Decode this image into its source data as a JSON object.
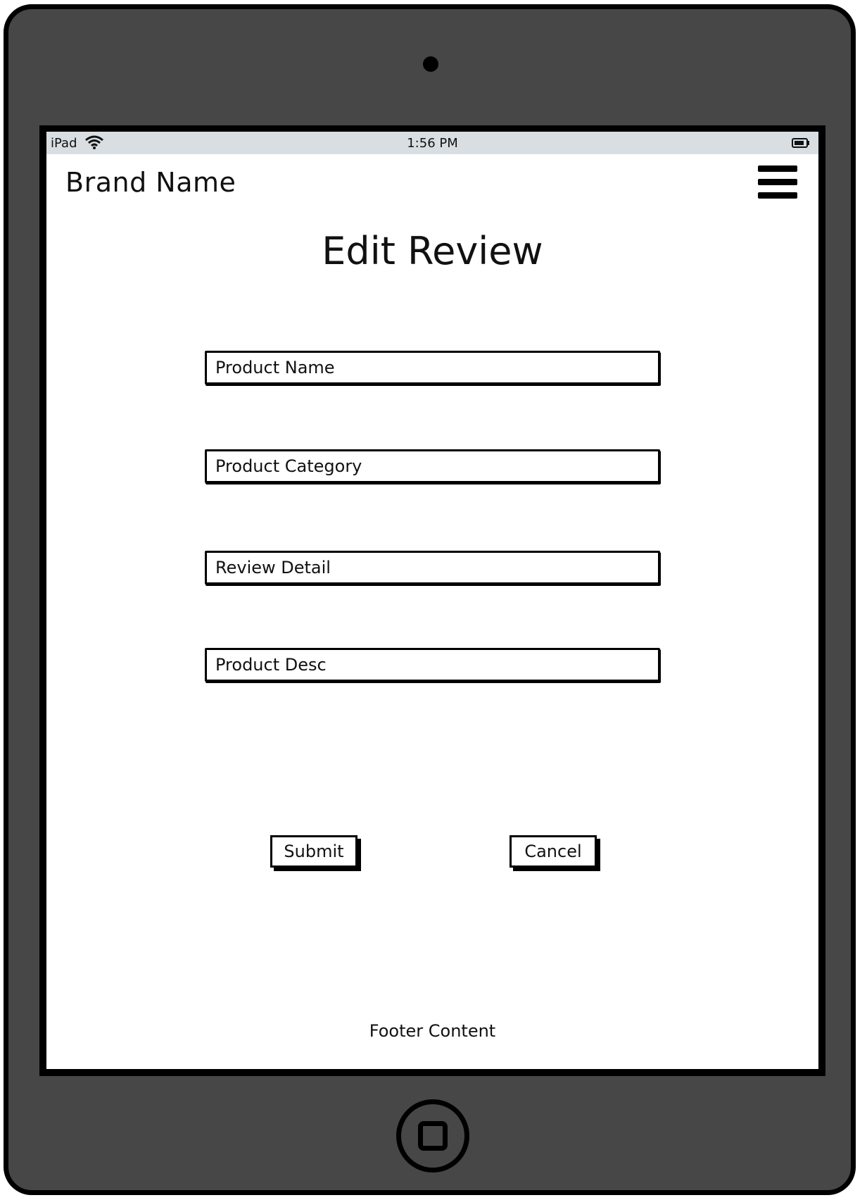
{
  "status_bar": {
    "carrier": "iPad",
    "time": "1:56 PM",
    "icons": [
      "wifi-icon",
      "battery-icon"
    ]
  },
  "header": {
    "brand": "Brand Name",
    "menu_icon": "hamburger-menu-icon"
  },
  "main": {
    "title": "Edit Review",
    "fields": [
      {
        "placeholder": "Product Name"
      },
      {
        "placeholder": "Product Category"
      },
      {
        "placeholder": "Review Detail"
      },
      {
        "placeholder": "Product Desc"
      }
    ],
    "submit_label": "Submit",
    "cancel_label": "Cancel"
  },
  "footer": {
    "text": "Footer Content"
  },
  "colors": {
    "device_body": "#474747",
    "status_bar": "#d8dee2",
    "screen": "#ffffff",
    "ink": "#000000"
  }
}
